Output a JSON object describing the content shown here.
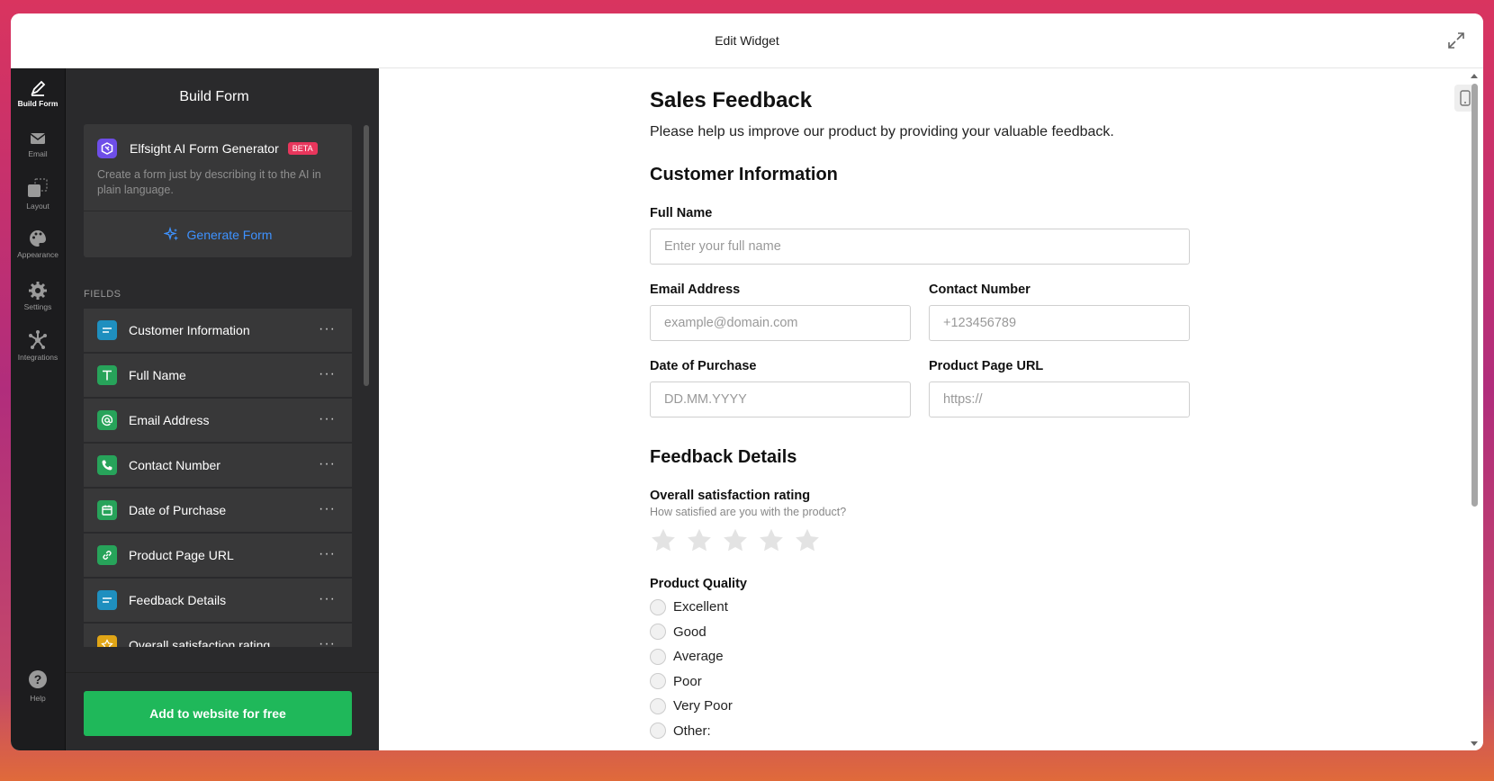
{
  "window": {
    "title": "Edit Widget"
  },
  "rail": {
    "items": [
      {
        "label": "Build Form",
        "icon": "pencil-icon"
      },
      {
        "label": "Email",
        "icon": "mail-icon"
      },
      {
        "label": "Layout",
        "icon": "layout-icon"
      },
      {
        "label": "Appearance",
        "icon": "palette-icon"
      },
      {
        "label": "Settings",
        "icon": "gear-icon"
      },
      {
        "label": "Integrations",
        "icon": "integrations-icon"
      }
    ],
    "help_label": "Help"
  },
  "panel": {
    "title": "Build Form",
    "ai": {
      "name": "Elfsight AI Form Generator",
      "badge": "BETA",
      "description": "Create a form just by describing it to the AI in plain language.",
      "button": "Generate Form"
    },
    "fields_label": "FIELDS",
    "fields": [
      {
        "name": "Customer Information",
        "icon": "heading-icon",
        "color": "#1f8fbf"
      },
      {
        "name": "Full Name",
        "icon": "text-icon",
        "color": "#27a35a"
      },
      {
        "name": "Email Address",
        "icon": "at-icon",
        "color": "#27a35a"
      },
      {
        "name": "Contact Number",
        "icon": "phone-icon",
        "color": "#27a35a"
      },
      {
        "name": "Date of Purchase",
        "icon": "calendar-icon",
        "color": "#27a35a"
      },
      {
        "name": "Product Page URL",
        "icon": "link-icon",
        "color": "#27a35a"
      },
      {
        "name": "Feedback Details",
        "icon": "heading-icon",
        "color": "#1f8fbf"
      },
      {
        "name": "Overall satisfaction rating",
        "icon": "star-icon",
        "color": "#e0a516"
      }
    ],
    "more_label": "···",
    "add_button": "Add to website for free"
  },
  "form": {
    "title": "Sales Feedback",
    "description": "Please help us improve our product by providing your valuable feedback.",
    "section1": "Customer Information",
    "full_name": {
      "label": "Full Name",
      "placeholder": "Enter your full name"
    },
    "email": {
      "label": "Email Address",
      "placeholder": "example@domain.com"
    },
    "phone": {
      "label": "Contact Number",
      "placeholder": "+123456789"
    },
    "date": {
      "label": "Date of Purchase",
      "placeholder": "DD.MM.YYYY"
    },
    "url": {
      "label": "Product Page URL",
      "placeholder": "https://"
    },
    "section2": "Feedback Details",
    "rating": {
      "label": "Overall satisfaction rating",
      "hint": "How satisfied are you with the product?",
      "max": 5,
      "value": 0
    },
    "quality": {
      "label": "Product Quality",
      "options": [
        "Excellent",
        "Good",
        "Average",
        "Poor",
        "Very Poor",
        "Other:"
      ]
    }
  },
  "colors": {
    "accent_blue": "#3e92ff",
    "cta_green": "#1fb85a",
    "beta_red": "#e8365c"
  }
}
